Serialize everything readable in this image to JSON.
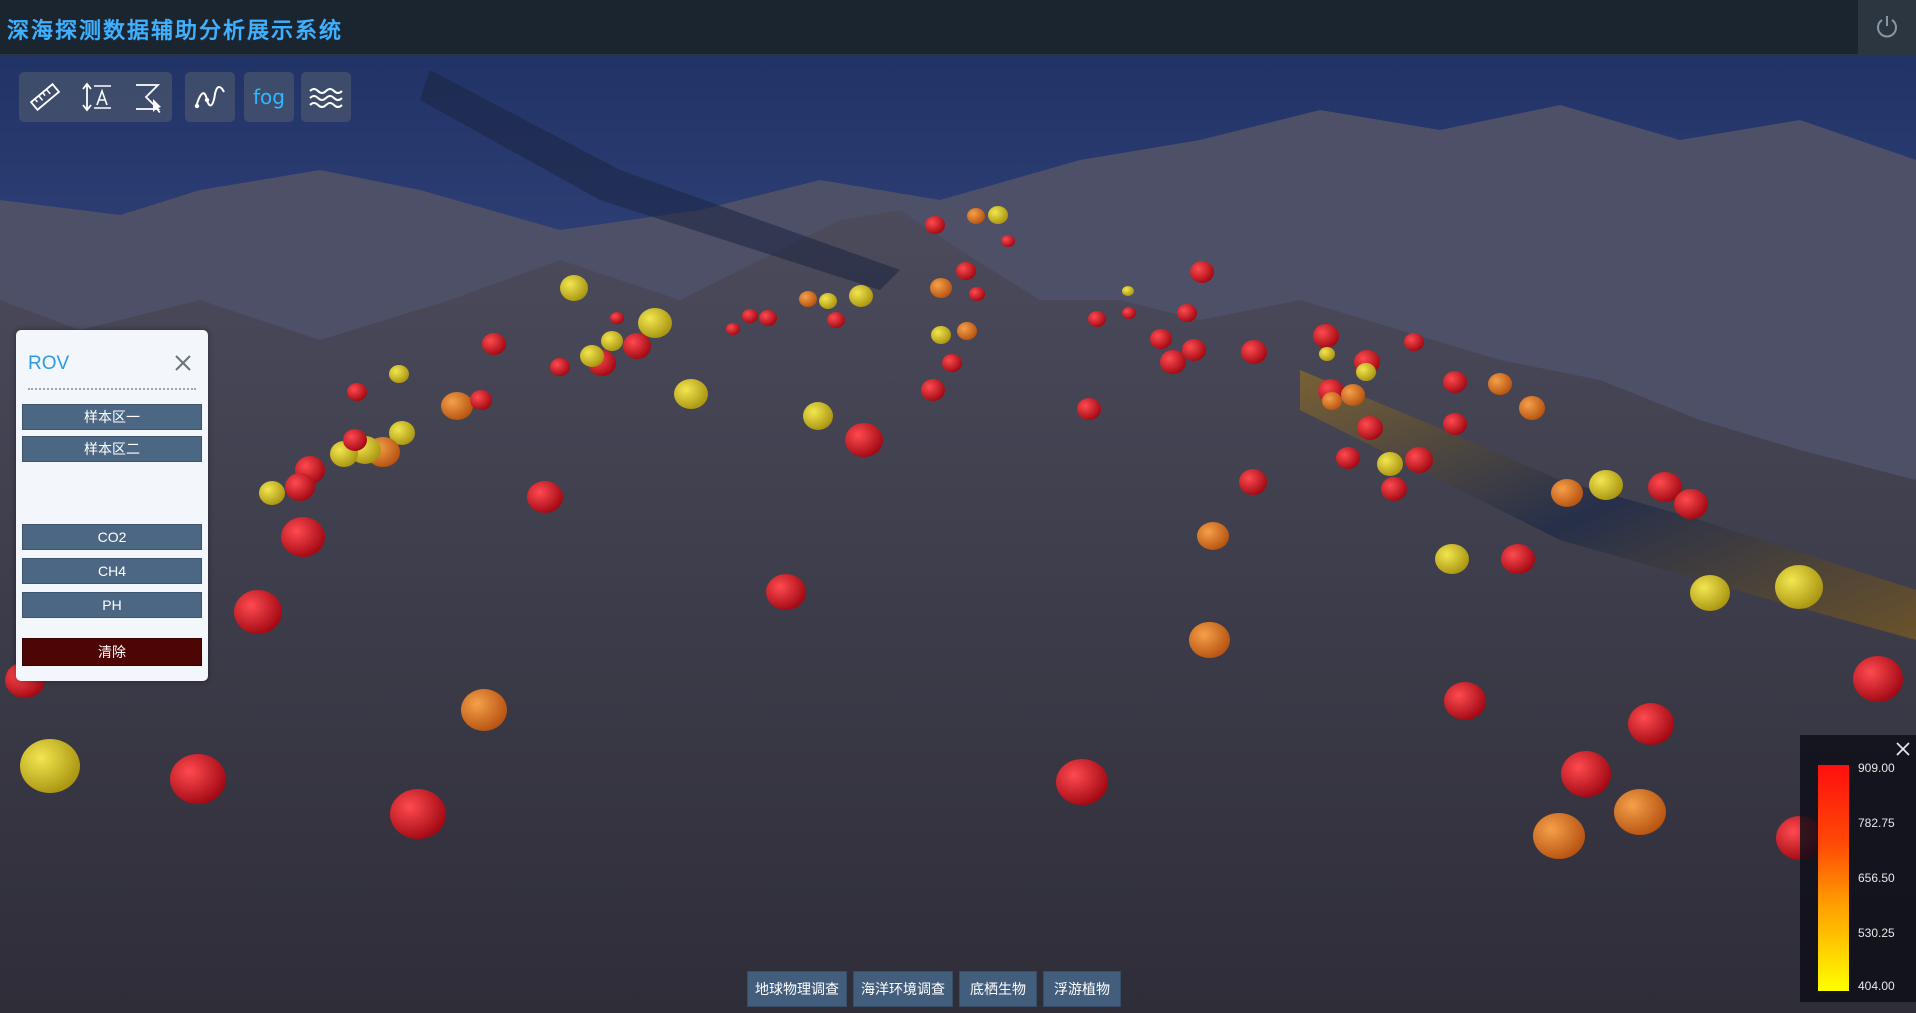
{
  "app": {
    "title": "深海探测数据辅助分析展示系统"
  },
  "toolbar": {
    "fog_label": "fog",
    "tools": [
      {
        "name": "ruler-icon"
      },
      {
        "name": "height-measure-icon"
      },
      {
        "name": "area-measure-icon"
      },
      {
        "name": "path-icon"
      },
      {
        "name": "fog-label"
      },
      {
        "name": "waves-icon"
      }
    ]
  },
  "rov_panel": {
    "title": "ROV",
    "areas": [
      "样本区一",
      "样本区二"
    ],
    "params": [
      "CO2",
      "CH4",
      "PH"
    ],
    "clear_label": "清除"
  },
  "legend": {
    "labels": [
      "909.00",
      "782.75",
      "656.50",
      "530.25",
      "404.00"
    ],
    "max": 909.0,
    "min": 404.0,
    "colors": [
      "#ff0f0f",
      "#ff4a06",
      "#ff9a00",
      "#ffd100",
      "#ffff00"
    ]
  },
  "bottom_tabs": [
    "地球物理调查",
    "海洋环境调查",
    "底栖生物",
    "浮游植物"
  ],
  "colors": {
    "title": "#3fb0ff",
    "accent": "#2fb8ff",
    "button": "#4c6784",
    "clear_button": "#4d0505",
    "marker_red": "#e01422",
    "marker_orange": "#e6761c",
    "marker_yellow": "#d4c21a"
  }
}
